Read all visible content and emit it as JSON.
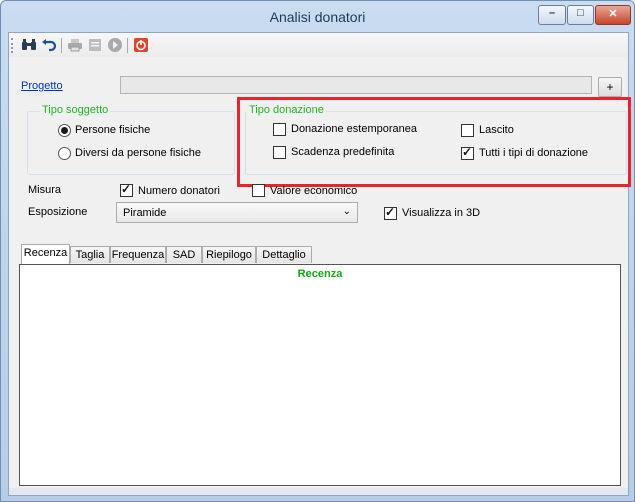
{
  "window": {
    "title": "Analisi donatori",
    "buttons": {
      "minimize": "–",
      "maximize": "□",
      "close": "✕"
    }
  },
  "toolbar": {
    "icons": [
      "binoculars-icon",
      "undo-icon",
      "print-icon",
      "export-icon",
      "next-icon",
      "exit-icon"
    ]
  },
  "progetto": {
    "label": "Progetto",
    "value": "",
    "button": "+"
  },
  "tipo_soggetto": {
    "title": "Tipo soggetto",
    "options": [
      {
        "label": "Persone fisiche",
        "selected": true
      },
      {
        "label": "Diversi da persone fisiche",
        "selected": false
      }
    ]
  },
  "tipo_donazione": {
    "title": "Tipo donazione",
    "options": [
      {
        "label": "Donazione estemporanea",
        "checked": false
      },
      {
        "label": "Lascito",
        "checked": false
      },
      {
        "label": "Scadenza predefinita",
        "checked": false
      },
      {
        "label": "Tutti i tipi di donazione",
        "checked": true
      }
    ]
  },
  "misura": {
    "label": "Misura",
    "options": [
      {
        "label": "Numero donatori",
        "checked": true
      },
      {
        "label": "Valore economico",
        "checked": false
      }
    ]
  },
  "esposizione": {
    "label": "Esposizione",
    "value": "Piramide"
  },
  "visualizza3d": {
    "label": "Visualizza in 3D",
    "checked": true
  },
  "tabs": [
    "Recenza",
    "Taglia",
    "Frequenza",
    "SAD",
    "Riepilogo",
    "Dettaglio"
  ],
  "active_tab": "Recenza",
  "panel": {
    "title": "Recenza"
  },
  "colors": {
    "accent_green": "#22b522",
    "highlight_red": "#e8232d",
    "link_blue": "#0033cc"
  }
}
